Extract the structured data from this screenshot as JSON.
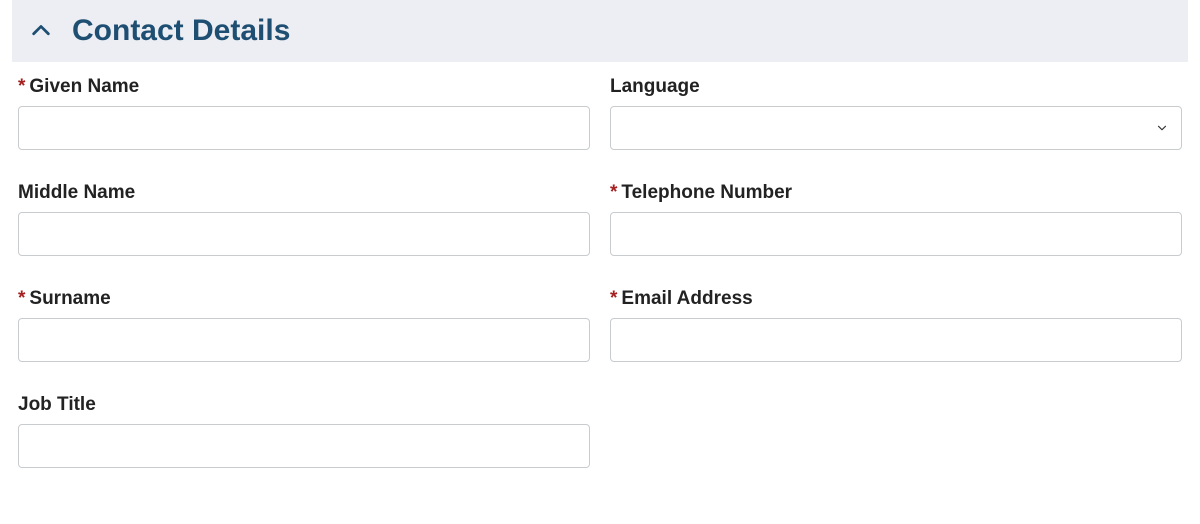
{
  "section": {
    "title": "Contact Details"
  },
  "labels": {
    "given_name": "Given Name",
    "middle_name": "Middle Name",
    "surname": "Surname",
    "job_title": "Job Title",
    "language": "Language",
    "telephone": "Telephone Number",
    "email": "Email Address",
    "required_mark": "*"
  },
  "values": {
    "given_name": "",
    "middle_name": "",
    "surname": "",
    "job_title": "",
    "language": "",
    "telephone": "",
    "email": ""
  }
}
